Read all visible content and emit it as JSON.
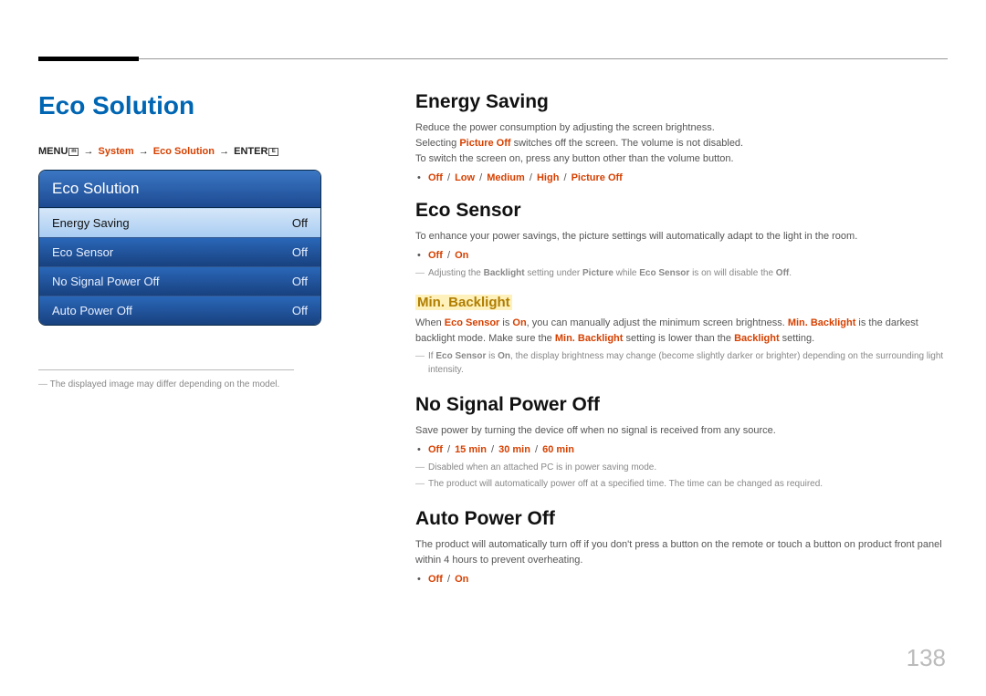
{
  "page_number": "138",
  "left": {
    "title": "Eco Solution",
    "breadcrumb": {
      "menu": "MENU",
      "system": "System",
      "eco": "Eco Solution",
      "enter": "ENTER"
    },
    "osd": {
      "header": "Eco Solution",
      "items": [
        {
          "label": "Energy Saving",
          "value": "Off",
          "selected": true
        },
        {
          "label": "Eco Sensor",
          "value": "Off",
          "selected": false
        },
        {
          "label": "No Signal Power Off",
          "value": "Off",
          "selected": false
        },
        {
          "label": "Auto Power Off",
          "value": "Off",
          "selected": false
        }
      ]
    },
    "caption": "The displayed image may differ depending on the model."
  },
  "right": {
    "energy_saving": {
      "title": "Energy Saving",
      "p1": "Reduce the power consumption by adjusting the screen brightness.",
      "p2a": "Selecting ",
      "p2b": "Picture Off",
      "p2c": " switches off the screen. The volume is not disabled.",
      "p3": "To switch the screen on, press any button other than the volume button.",
      "opts": [
        "Off",
        "Low",
        "Medium",
        "High",
        "Picture Off"
      ]
    },
    "eco_sensor": {
      "title": "Eco Sensor",
      "p1": "To enhance your power savings, the picture settings will automatically adapt to the light in the room.",
      "opts": [
        "Off",
        "On"
      ],
      "note1": {
        "a": "Adjusting the ",
        "b1": "Backlight",
        "c": " setting under ",
        "b2": "Picture",
        "d": " while ",
        "b3": "Eco Sensor",
        "e": " is on will disable the ",
        "b4": "Off",
        "f": "."
      },
      "sub": {
        "title": "Min. Backlight",
        "p_a": "When ",
        "p_b1": "Eco Sensor",
        "p_c": " is ",
        "p_b2": "On",
        "p_d": ", you can manually adjust the minimum screen brightness. ",
        "p_b3": "Min. Backlight",
        "p_e": " is the darkest backlight mode. Make sure the ",
        "p_b4": "Min. Backlight",
        "p_f": " setting is lower than the ",
        "p_b5": "Backlight",
        "p_g": " setting.",
        "n2a": "If ",
        "n2b1": "Eco Sensor",
        "n2c": " is ",
        "n2b2": "On",
        "n2d": ", the display brightness may change (become slightly darker or brighter) depending on the surrounding light intensity."
      }
    },
    "no_signal": {
      "title": "No Signal Power Off",
      "p1": "Save power by turning the device off when no signal is received from any source.",
      "opts": [
        "Off",
        "15 min",
        "30 min",
        "60 min"
      ],
      "n1": "Disabled when an attached PC is in power saving mode.",
      "n2": "The product will automatically power off at a specified time. The time can be changed as required."
    },
    "auto_power": {
      "title": "Auto Power Off",
      "p1": "The product will automatically turn off if you don't press a button on the remote or touch a button on product front panel within 4 hours to prevent overheating.",
      "opts": [
        "Off",
        "On"
      ]
    }
  }
}
